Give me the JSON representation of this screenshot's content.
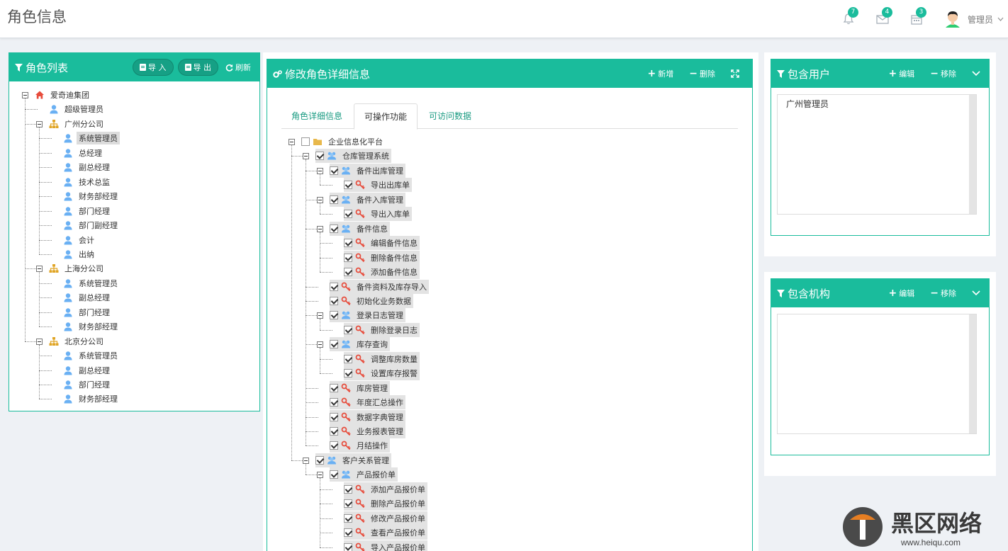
{
  "header": {
    "title": "角色信息",
    "notifications": {
      "icon": "bell-icon",
      "count": "7"
    },
    "messages": {
      "icon": "envelope-icon",
      "count": "4"
    },
    "calendar": {
      "icon": "calendar-icon",
      "count": "3"
    },
    "user": {
      "name": "管理员",
      "icon": "avatar-icon"
    }
  },
  "colors": {
    "accent": "#1abc9c",
    "accent_dark": "#16a085",
    "key_icon": "#e74c3c",
    "user_icon": "#6ab0f3",
    "org_icon": "#e0a526",
    "folder_icon": "#e8b84b"
  },
  "role_list": {
    "title": "角色列表",
    "import_label": "导 入",
    "export_label": "导 出",
    "refresh_label": "刷新",
    "tree": [
      {
        "label": "爱奇迪集团",
        "type": "home",
        "level": 0,
        "toggle": true
      },
      {
        "label": "超级管理员",
        "type": "user",
        "level": 1
      },
      {
        "label": "广州分公司",
        "type": "org",
        "level": 1,
        "toggle": true
      },
      {
        "label": "系统管理员",
        "type": "user",
        "level": 2,
        "selected": true
      },
      {
        "label": "总经理",
        "type": "user",
        "level": 2
      },
      {
        "label": "副总经理",
        "type": "user",
        "level": 2
      },
      {
        "label": "技术总监",
        "type": "user",
        "level": 2
      },
      {
        "label": "财务部经理",
        "type": "user",
        "level": 2
      },
      {
        "label": "部门经理",
        "type": "user",
        "level": 2
      },
      {
        "label": "部门副经理",
        "type": "user",
        "level": 2
      },
      {
        "label": "会计",
        "type": "user",
        "level": 2
      },
      {
        "label": "出纳",
        "type": "user",
        "level": 2
      },
      {
        "label": "上海分公司",
        "type": "org",
        "level": 1,
        "toggle": true
      },
      {
        "label": "系统管理员",
        "type": "user",
        "level": 2
      },
      {
        "label": "副总经理",
        "type": "user",
        "level": 2
      },
      {
        "label": "部门经理",
        "type": "user",
        "level": 2
      },
      {
        "label": "财务部经理",
        "type": "user",
        "level": 2
      },
      {
        "label": "北京分公司",
        "type": "org",
        "level": 1,
        "toggle": true
      },
      {
        "label": "系统管理员",
        "type": "user",
        "level": 2
      },
      {
        "label": "副总经理",
        "type": "user",
        "level": 2
      },
      {
        "label": "部门经理",
        "type": "user",
        "level": 2
      },
      {
        "label": "财务部经理",
        "type": "user",
        "level": 2
      }
    ]
  },
  "role_detail": {
    "title": "修改角色详细信息",
    "add_label": "新增",
    "delete_label": "删除",
    "tabs": [
      {
        "label": "角色详细信息",
        "active": false
      },
      {
        "label": "可操作功能",
        "active": true
      },
      {
        "label": "可访问数据",
        "active": false
      }
    ],
    "func_tree": [
      {
        "label": "企业信息化平台",
        "type": "folder",
        "level": 0,
        "toggle": true,
        "checked": false
      },
      {
        "label": "仓库管理系统",
        "type": "group",
        "level": 1,
        "toggle": true,
        "checked": true
      },
      {
        "label": "备件出库管理",
        "type": "group",
        "level": 2,
        "toggle": true,
        "checked": true
      },
      {
        "label": "导出出库单",
        "type": "key",
        "level": 3,
        "checked": true
      },
      {
        "label": "备件入库管理",
        "type": "group",
        "level": 2,
        "toggle": true,
        "checked": true
      },
      {
        "label": "导出入库单",
        "type": "key",
        "level": 3,
        "checked": true
      },
      {
        "label": "备件信息",
        "type": "group",
        "level": 2,
        "toggle": true,
        "checked": true
      },
      {
        "label": "编辑备件信息",
        "type": "key",
        "level": 3,
        "checked": true
      },
      {
        "label": "删除备件信息",
        "type": "key",
        "level": 3,
        "checked": true
      },
      {
        "label": "添加备件信息",
        "type": "key",
        "level": 3,
        "checked": true
      },
      {
        "label": "备件资料及库存导入",
        "type": "key",
        "level": 2,
        "checked": true
      },
      {
        "label": "初始化业务数据",
        "type": "key",
        "level": 2,
        "checked": true
      },
      {
        "label": "登录日志管理",
        "type": "group",
        "level": 2,
        "toggle": true,
        "checked": true
      },
      {
        "label": "删除登录日志",
        "type": "key",
        "level": 3,
        "checked": true
      },
      {
        "label": "库存查询",
        "type": "group",
        "level": 2,
        "toggle": true,
        "checked": true
      },
      {
        "label": "调整库房数量",
        "type": "key",
        "level": 3,
        "checked": true
      },
      {
        "label": "设置库存报警",
        "type": "key",
        "level": 3,
        "checked": true
      },
      {
        "label": "库房管理",
        "type": "key",
        "level": 2,
        "checked": true
      },
      {
        "label": "年度汇总操作",
        "type": "key",
        "level": 2,
        "checked": true
      },
      {
        "label": "数据字典管理",
        "type": "key",
        "level": 2,
        "checked": true
      },
      {
        "label": "业务报表管理",
        "type": "key",
        "level": 2,
        "checked": true
      },
      {
        "label": "月结操作",
        "type": "key",
        "level": 2,
        "checked": true
      },
      {
        "label": "客户关系管理",
        "type": "group",
        "level": 1,
        "toggle": true,
        "checked": true
      },
      {
        "label": "产品报价单",
        "type": "group",
        "level": 2,
        "toggle": true,
        "checked": true
      },
      {
        "label": "添加产品报价单",
        "type": "key",
        "level": 3,
        "checked": true
      },
      {
        "label": "删除产品报价单",
        "type": "key",
        "level": 3,
        "checked": true
      },
      {
        "label": "修改产品报价单",
        "type": "key",
        "level": 3,
        "checked": true
      },
      {
        "label": "查看产品报价单",
        "type": "key",
        "level": 3,
        "checked": true
      },
      {
        "label": "导入产品报价单",
        "type": "key",
        "level": 3,
        "checked": true
      }
    ]
  },
  "users_panel": {
    "title": "包含用户",
    "edit_label": "编辑",
    "remove_label": "移除",
    "items": [
      "广州管理员"
    ]
  },
  "org_panel": {
    "title": "包含机构",
    "edit_label": "编辑",
    "remove_label": "移除",
    "items": []
  },
  "watermark": {
    "text": "黑区网络",
    "url": "www.heiqu.com"
  }
}
